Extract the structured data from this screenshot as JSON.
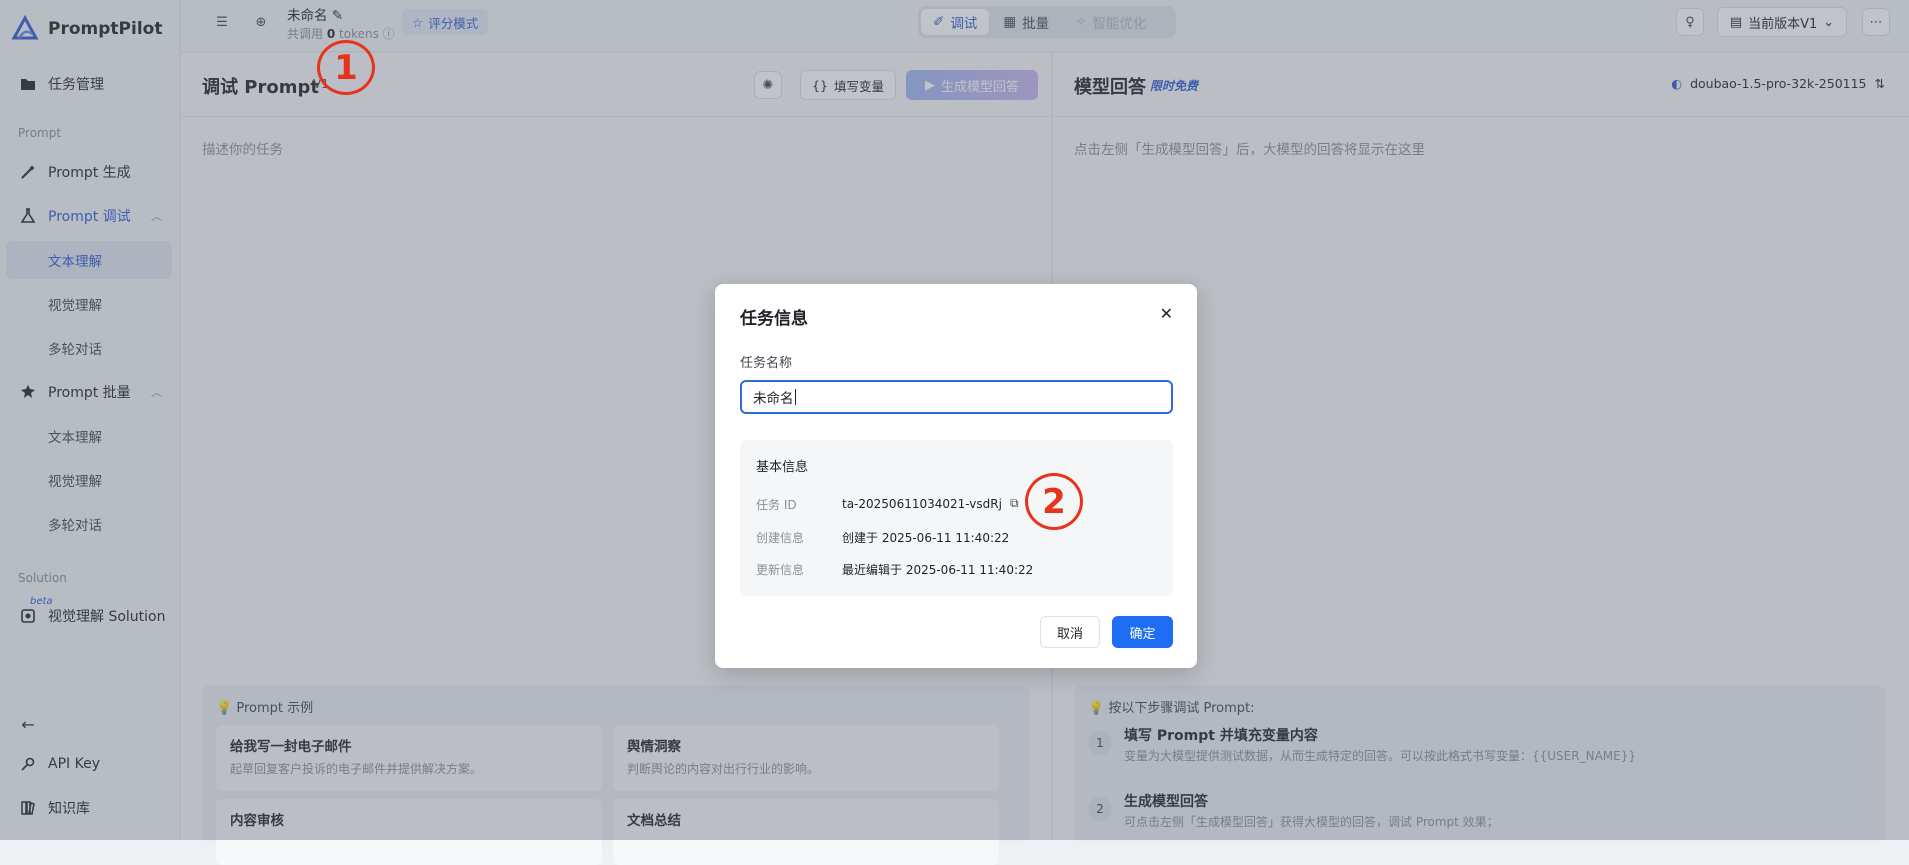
{
  "app": {
    "name": "PromptPilot"
  },
  "sidebar": {
    "task_mgmt": "任务管理",
    "group_prompt": "Prompt",
    "prompt_gen": "Prompt 生成",
    "prompt_debug": "Prompt 调试",
    "debug_items": [
      "文本理解",
      "视觉理解",
      "多轮对话"
    ],
    "prompt_batch": "Prompt 批量",
    "batch_items": [
      "文本理解",
      "视觉理解",
      "多轮对话"
    ],
    "group_solution": "Solution",
    "beta": "beta",
    "vision_solution": "视觉理解 Solution",
    "api_key": "API Key",
    "kb": "知识库"
  },
  "topbar": {
    "task_name": "未命名",
    "tokens_prefix": "共调用",
    "tokens_value": "0",
    "tokens_suffix": "tokens",
    "eval_mode": "评分模式",
    "tabs": [
      "调试",
      "批量",
      "智能优化"
    ],
    "version": "当前版本V1"
  },
  "left_pane": {
    "title": "调试 Prompt",
    "version_tag": "V1",
    "fill_vars": "填写变量",
    "generate": "生成模型回答",
    "placeholder": "描述你的任务",
    "examples_title": "Prompt 示例",
    "examples": [
      {
        "title": "给我写一封电子邮件",
        "desc": "起草回复客户投诉的电子邮件并提供解决方案。"
      },
      {
        "title": "舆情洞察",
        "desc": "判断舆论的内容对出行行业的影响。"
      },
      {
        "title": "内容审核",
        "desc": ""
      },
      {
        "title": "文档总结",
        "desc": ""
      }
    ]
  },
  "right_pane": {
    "title": "模型回答",
    "free_tag": "限时免费",
    "model": "doubao-1.5-pro-32k-250115",
    "placeholder": "点击左侧「生成模型回答」后，大模型的回答将显示在这里",
    "steps_title": "按以下步骤调试 Prompt:",
    "steps": [
      {
        "num": "1",
        "title": "填写 Prompt 并填充变量内容",
        "desc": "变量为大模型提供测试数据，从而生成特定的回答。可以按此格式书写变量：{{USER_NAME}}"
      },
      {
        "num": "2",
        "title": "生成模型回答",
        "desc": "可点击左侧「生成模型回答」获得大模型的回答，调试 Prompt 效果；"
      }
    ]
  },
  "modal": {
    "title": "任务信息",
    "name_label": "任务名称",
    "name_value": "未命名",
    "basic_info": "基本信息",
    "id_label": "任务 ID",
    "id_value": "ta-20250611034021-vsdRj",
    "created_label": "创建信息",
    "created_value": "创建于 2025-06-11 11:40:22",
    "updated_label": "更新信息",
    "updated_value": "最近编辑于 2025-06-11 11:40:22",
    "cancel": "取消",
    "confirm": "确定"
  },
  "annotations": [
    "1",
    "2"
  ],
  "colors": {
    "accent": "#2f5bd9",
    "confirm": "#1f6df2",
    "annotation": "#e8331c"
  }
}
